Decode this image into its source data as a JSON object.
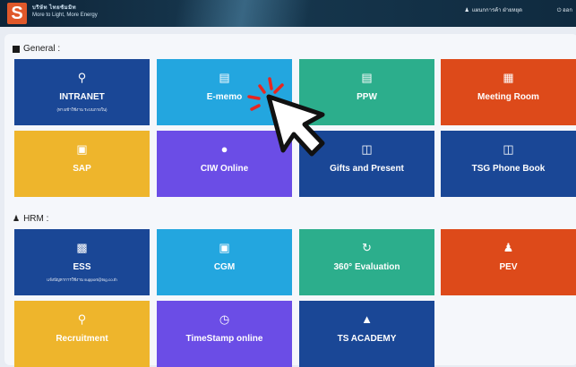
{
  "header": {
    "logo_letter": "S",
    "org_name": "บริษัท ไทยซัมมิท",
    "org_sub": "More to Light, More Energy",
    "user_label": "แผนกการค้า ฝ่ายหยุด",
    "power_label": "ออก"
  },
  "sections": {
    "general": "General :",
    "hrm": "HRM :"
  },
  "general_tiles": [
    {
      "label": "INTRANET",
      "sub": "(ทางเข้าใช้งาน ระบบภายใน)",
      "icon": "map-pin-icon"
    },
    {
      "label": "E-memo",
      "icon": "document-icon"
    },
    {
      "label": "PPW",
      "icon": "window-icon"
    },
    {
      "label": "Meeting Room",
      "icon": "calendar-icon"
    },
    {
      "label": "SAP",
      "icon": "screen-icon"
    },
    {
      "label": "CIW Online",
      "icon": "globe-icon"
    },
    {
      "label": "Gifts and Present",
      "icon": "gift-icon"
    },
    {
      "label": "TSG Phone Book",
      "icon": "gift-icon"
    }
  ],
  "hrm_tiles": [
    {
      "label": "ESS",
      "sub": "แจ้งปัญหาการใช้งาน support@tsg.co.th",
      "icon": "id-card-icon"
    },
    {
      "label": "CGM",
      "icon": "car-icon"
    },
    {
      "label": "360° Evaluation",
      "icon": "refresh-icon"
    },
    {
      "label": "PEV",
      "icon": "user-check-icon"
    },
    {
      "label": "Recruitment",
      "icon": "search-user-icon"
    },
    {
      "label": "TimeStamp online",
      "icon": "stopwatch-icon"
    },
    {
      "label": "TS ACADEMY",
      "icon": "graduation-icon"
    }
  ],
  "colors": {
    "navy": "#1a4796",
    "cyan": "#23a6df",
    "green": "#2cae8c",
    "orange": "#dd4a1a",
    "yellow": "#eeb52c",
    "purple": "#6b4de6"
  }
}
